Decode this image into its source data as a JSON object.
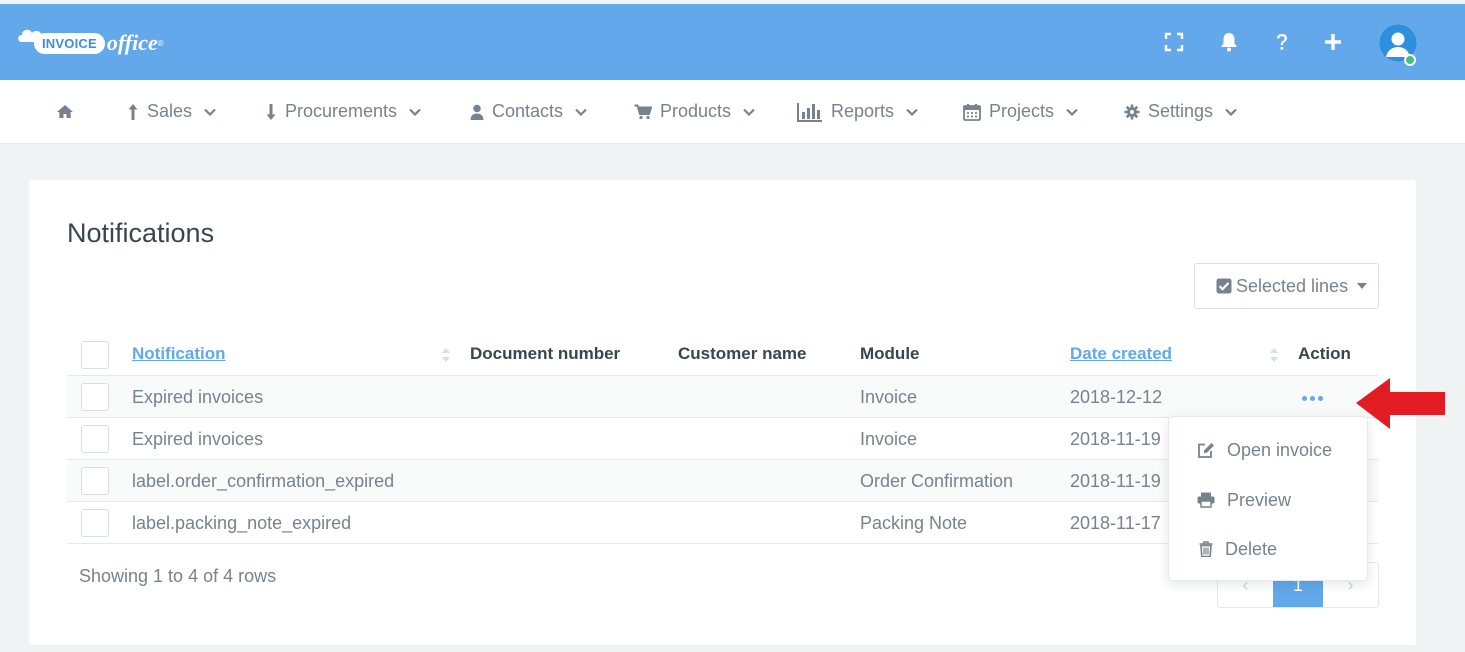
{
  "app": {
    "logo_left": "INVOICE",
    "logo_right": "office",
    "logo_mark": "®"
  },
  "topbar_icons": [
    "fullscreen-icon",
    "bell-icon",
    "question-icon",
    "plus-icon",
    "user-avatar-icon"
  ],
  "colors": {
    "topbar": "#62a8ea",
    "accent": "#62a8ea",
    "text_muted": "#76838f",
    "title": "#37474f",
    "arrow": "#e31b23",
    "status_online": "#46be8a"
  },
  "nav": {
    "home_icon": "home-icon",
    "items": [
      {
        "label": "Sales",
        "icon": "arrow-up-icon"
      },
      {
        "label": "Procurements",
        "icon": "arrow-down-icon"
      },
      {
        "label": "Contacts",
        "icon": "person-icon"
      },
      {
        "label": "Products",
        "icon": "cart-icon"
      },
      {
        "label": "Reports",
        "icon": "bar-chart-icon"
      },
      {
        "label": "Projects",
        "icon": "calendar-icon"
      },
      {
        "label": "Settings",
        "icon": "gear-icon"
      }
    ]
  },
  "page": {
    "title": "Notifications",
    "selected_lines_label": "Selected lines"
  },
  "table": {
    "headers": {
      "notification": "Notification",
      "document_number": "Document number",
      "customer_name": "Customer name",
      "module": "Module",
      "date_created": "Date created",
      "action": "Action"
    },
    "rows": [
      {
        "notification": "Expired invoices",
        "document_number": "",
        "customer_name": "",
        "module": "Invoice",
        "date_created": "2018-12-12"
      },
      {
        "notification": "Expired invoices",
        "document_number": "",
        "customer_name": "",
        "module": "Invoice",
        "date_created": "2018-11-19"
      },
      {
        "notification": "label.order_confirmation_expired",
        "document_number": "",
        "customer_name": "",
        "module": "Order Confirmation",
        "date_created": "2018-11-19"
      },
      {
        "notification": "label.packing_note_expired",
        "document_number": "",
        "customer_name": "",
        "module": "Packing Note",
        "date_created": "2018-11-17"
      }
    ],
    "footer": "Showing 1 to 4 of 4 rows"
  },
  "pagination": {
    "prev": "‹",
    "current": "1",
    "next": "›"
  },
  "action_menu": {
    "items": [
      {
        "label": "Open invoice",
        "icon": "edit-icon"
      },
      {
        "label": "Preview",
        "icon": "print-icon"
      },
      {
        "label": "Delete",
        "icon": "trash-icon"
      }
    ]
  }
}
